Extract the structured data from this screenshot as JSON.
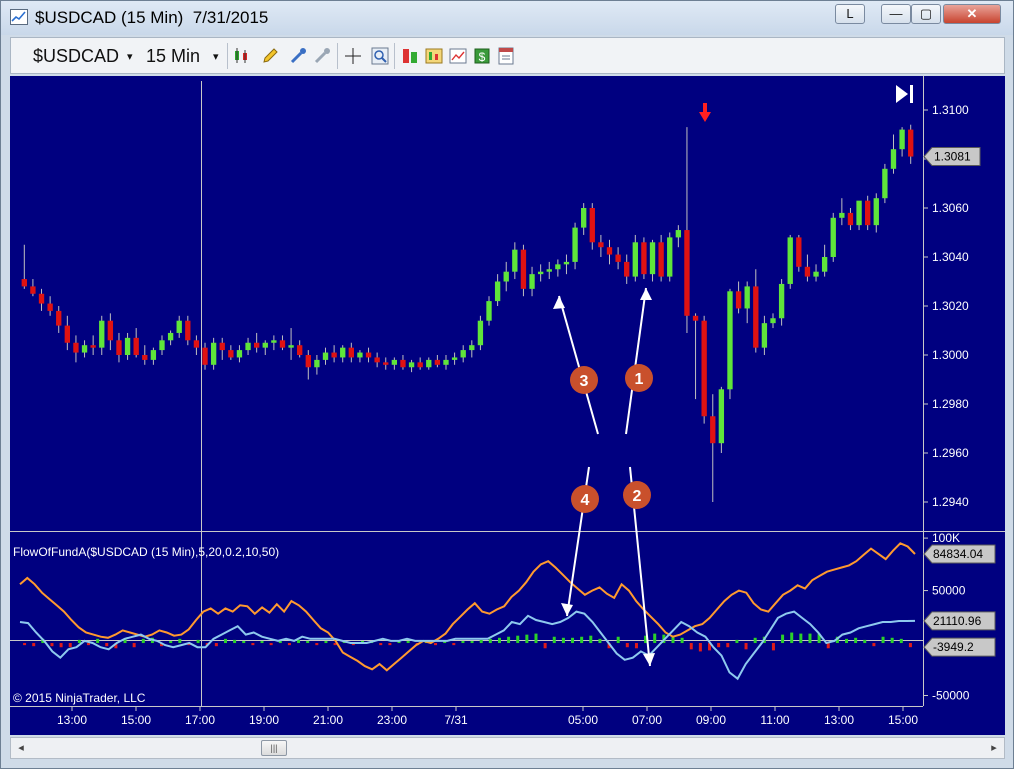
{
  "window": {
    "title": "$USDCAD (15 Min)  7/31/2015",
    "buttons": {
      "layout": "L",
      "minimize": "—",
      "maximize": "▢",
      "close": "✕"
    }
  },
  "toolbar": {
    "instrument": "$USDCAD",
    "instrument_arrow": "▾",
    "interval": "15 Min",
    "interval_arrow": "▾",
    "icons": [
      "candlestick-icon",
      "pencil-icon",
      "eyedropper-icon",
      "magnet-icon",
      "crosshair-icon",
      "zoom-icon",
      "strategy-icon",
      "bar-type-icon",
      "data-box-icon",
      "dollar-icon",
      "properties-icon"
    ]
  },
  "colors": {
    "background": "#000080",
    "up_candle": "#5fe53a",
    "down_candle": "#e01212",
    "wick": "#c0c0c0",
    "fund_line": "#ff9a2e",
    "signal_line": "#8ec9ee",
    "histogram_up": "#2bd12b",
    "histogram_down": "#e01a1a",
    "callout": "#c9502c",
    "scale_box": "#c8c8c8"
  },
  "chart_data": [
    {
      "type": "candlestick",
      "title": "$USDCAD (15 Min)",
      "price_axis_ticks": [
        "1.3100",
        "1.3080",
        "1.3060",
        "1.3040",
        "1.3020",
        "1.3000",
        "1.2980",
        "1.2960",
        "1.2940"
      ],
      "ylim": [
        1.2924,
        1.3111
      ],
      "time_axis_ticks": [
        "13:00",
        "15:00",
        "17:00",
        "19:00",
        "21:00",
        "23:00",
        "7/31",
        "05:00",
        "07:00",
        "09:00",
        "11:00",
        "13:00",
        "15:00"
      ],
      "last_price_marker": "1.3081",
      "skip_to_end_icon": "skip-to-end-icon",
      "event_marker": "down-arrow-icon",
      "ohlc": [
        [
          1.3031,
          1.3045,
          1.3027,
          1.3028
        ],
        [
          1.3028,
          1.3031,
          1.3024,
          1.3025
        ],
        [
          1.3025,
          1.3027,
          1.3018,
          1.3021
        ],
        [
          1.3021,
          1.3024,
          1.3016,
          1.3018
        ],
        [
          1.3018,
          1.302,
          1.3009,
          1.3012
        ],
        [
          1.3012,
          1.3016,
          1.3002,
          1.3005
        ],
        [
          1.3005,
          1.3008,
          1.2997,
          1.3001
        ],
        [
          1.3001,
          1.3006,
          1.2999,
          1.3004
        ],
        [
          1.3004,
          1.3008,
          1.3,
          1.3003
        ],
        [
          1.3003,
          1.3016,
          1.3,
          1.3014
        ],
        [
          1.3014,
          1.3017,
          1.3002,
          1.3006
        ],
        [
          1.3006,
          1.3009,
          1.2997,
          1.3
        ],
        [
          1.3,
          1.3009,
          1.2998,
          1.3007
        ],
        [
          1.3007,
          1.3011,
          1.2999,
          1.3
        ],
        [
          1.3,
          1.3004,
          1.2996,
          1.2998
        ],
        [
          1.2998,
          1.3003,
          1.2996,
          1.3002
        ],
        [
          1.3002,
          1.3008,
          1.3,
          1.3006
        ],
        [
          1.3006,
          1.301,
          1.3004,
          1.3009
        ],
        [
          1.3009,
          1.3016,
          1.3007,
          1.3014
        ],
        [
          1.3014,
          1.3016,
          1.3004,
          1.3006
        ],
        [
          1.3006,
          1.3008,
          1.3,
          1.3003
        ],
        [
          1.3003,
          1.3005,
          1.2994,
          1.2996
        ],
        [
          1.2996,
          1.3007,
          1.2994,
          1.3005
        ],
        [
          1.3005,
          1.3007,
          1.2998,
          1.3002
        ],
        [
          1.3002,
          1.3004,
          1.2998,
          1.2999
        ],
        [
          1.2999,
          1.3004,
          1.2997,
          1.3002
        ],
        [
          1.3002,
          1.3007,
          1.3,
          1.3005
        ],
        [
          1.3005,
          1.3009,
          1.3001,
          1.3003
        ],
        [
          1.3003,
          1.3006,
          1.3,
          1.3005
        ],
        [
          1.3005,
          1.3008,
          1.3002,
          1.3006
        ],
        [
          1.3006,
          1.3008,
          1.3002,
          1.3003
        ],
        [
          1.3003,
          1.3011,
          1.2998,
          1.3004
        ],
        [
          1.3004,
          1.3006,
          1.2999,
          1.3
        ],
        [
          1.3,
          1.3002,
          1.299,
          1.2995
        ],
        [
          1.2995,
          1.3,
          1.2992,
          1.2998
        ],
        [
          1.2998,
          1.3003,
          1.2996,
          1.3001
        ],
        [
          1.3001,
          1.3004,
          1.2997,
          1.2999
        ],
        [
          1.2999,
          1.3004,
          1.2997,
          1.3003
        ],
        [
          1.3003,
          1.3005,
          1.2997,
          1.2999
        ],
        [
          1.2999,
          1.3002,
          1.2997,
          1.3001
        ],
        [
          1.3001,
          1.3003,
          1.2997,
          1.2999
        ],
        [
          1.2999,
          1.3001,
          1.2995,
          1.2997
        ],
        [
          1.2997,
          1.2999,
          1.2994,
          1.2996
        ],
        [
          1.2996,
          1.2999,
          1.2994,
          1.2998
        ],
        [
          1.2998,
          1.3,
          1.2994,
          1.2995
        ],
        [
          1.2995,
          1.2998,
          1.2993,
          1.2997
        ],
        [
          1.2997,
          1.2999,
          1.2994,
          1.2995
        ],
        [
          1.2995,
          1.2999,
          1.2994,
          1.2998
        ],
        [
          1.2998,
          1.3,
          1.2995,
          1.2996
        ],
        [
          1.2996,
          1.3,
          1.2994,
          1.2998
        ],
        [
          1.2998,
          1.3001,
          1.2996,
          1.2999
        ],
        [
          1.2999,
          1.3004,
          1.2997,
          1.3002
        ],
        [
          1.3002,
          1.3006,
          1.2999,
          1.3004
        ],
        [
          1.3004,
          1.3016,
          1.3002,
          1.3014
        ],
        [
          1.3014,
          1.3024,
          1.3012,
          1.3022
        ],
        [
          1.3022,
          1.3033,
          1.302,
          1.303
        ],
        [
          1.303,
          1.3038,
          1.3026,
          1.3034
        ],
        [
          1.3034,
          1.3046,
          1.3031,
          1.3043
        ],
        [
          1.3043,
          1.3045,
          1.3024,
          1.3027
        ],
        [
          1.3027,
          1.3036,
          1.3024,
          1.3033
        ],
        [
          1.3033,
          1.3037,
          1.303,
          1.3034
        ],
        [
          1.3034,
          1.3038,
          1.3031,
          1.3035
        ],
        [
          1.3035,
          1.3039,
          1.3032,
          1.3037
        ],
        [
          1.3037,
          1.3041,
          1.3033,
          1.3038
        ],
        [
          1.3038,
          1.3054,
          1.3035,
          1.3052
        ],
        [
          1.3052,
          1.3062,
          1.3049,
          1.306
        ],
        [
          1.306,
          1.3062,
          1.3043,
          1.3046
        ],
        [
          1.3046,
          1.3049,
          1.304,
          1.3044
        ],
        [
          1.3044,
          1.3047,
          1.3037,
          1.3041
        ],
        [
          1.3041,
          1.3044,
          1.3035,
          1.3038
        ],
        [
          1.3038,
          1.3041,
          1.3029,
          1.3032
        ],
        [
          1.3032,
          1.3049,
          1.303,
          1.3046
        ],
        [
          1.3046,
          1.3048,
          1.3031,
          1.3033
        ],
        [
          1.3033,
          1.3047,
          1.303,
          1.3046
        ],
        [
          1.3046,
          1.3049,
          1.303,
          1.3032
        ],
        [
          1.3032,
          1.305,
          1.303,
          1.3048
        ],
        [
          1.3048,
          1.3053,
          1.3044,
          1.3051
        ],
        [
          1.3051,
          1.3093,
          1.3009,
          1.3016
        ],
        [
          1.3016,
          1.3017,
          1.2982,
          1.3014
        ],
        [
          1.3014,
          1.3016,
          1.2972,
          1.2975
        ],
        [
          1.2975,
          1.2984,
          1.294,
          1.2964
        ],
        [
          1.2964,
          1.2987,
          1.296,
          1.2986
        ],
        [
          1.2986,
          1.3027,
          1.2982,
          1.3026
        ],
        [
          1.3026,
          1.303,
          1.3017,
          1.3019
        ],
        [
          1.3019,
          1.303,
          1.3013,
          1.3028
        ],
        [
          1.3028,
          1.3035,
          1.3001,
          1.3003
        ],
        [
          1.3003,
          1.3016,
          1.3,
          1.3013
        ],
        [
          1.3013,
          1.3017,
          1.3011,
          1.3015
        ],
        [
          1.3015,
          1.3031,
          1.3012,
          1.3029
        ],
        [
          1.3029,
          1.3049,
          1.3027,
          1.3048
        ],
        [
          1.3048,
          1.3049,
          1.3034,
          1.3036
        ],
        [
          1.3036,
          1.3041,
          1.303,
          1.3032
        ],
        [
          1.3032,
          1.3037,
          1.303,
          1.3034
        ],
        [
          1.3034,
          1.3045,
          1.3032,
          1.304
        ],
        [
          1.304,
          1.3058,
          1.3038,
          1.3056
        ],
        [
          1.3056,
          1.3064,
          1.3053,
          1.3058
        ],
        [
          1.3058,
          1.306,
          1.3051,
          1.3053
        ],
        [
          1.3053,
          1.3061,
          1.3051,
          1.3063
        ],
        [
          1.3063,
          1.3065,
          1.3051,
          1.3053
        ],
        [
          1.3053,
          1.3066,
          1.305,
          1.3064
        ],
        [
          1.3064,
          1.3078,
          1.3062,
          1.3076
        ],
        [
          1.3076,
          1.309,
          1.3074,
          1.3084
        ],
        [
          1.3084,
          1.3093,
          1.3081,
          1.3092
        ],
        [
          1.3092,
          1.3094,
          1.3078,
          1.3081
        ]
      ]
    },
    {
      "type": "line",
      "title": "FlowOfFundA($USDCAD (15 Min),5,20,0.2,10,50)",
      "axis_ticks": [
        "100K",
        "50000",
        "-50000"
      ],
      "ylim": [
        -60000,
        102000
      ],
      "value_markers": [
        "84834.04",
        "21110.96",
        "-3949.2"
      ],
      "copyright": "© 2015 NinjaTrader, LLC",
      "series": [
        {
          "values": [
            56000,
            62000,
            56000,
            48000,
            42000,
            36000,
            30000,
            22000,
            15000,
            10000,
            8000,
            6000,
            5000,
            8000,
            12000,
            10000,
            8000,
            6000,
            8000,
            12000,
            10000,
            7000,
            8000,
            13000,
            22000,
            30000,
            33000,
            28000,
            33000,
            30000,
            36000,
            35000,
            28000,
            34000,
            29000,
            37000,
            30000,
            40000,
            36000,
            30000,
            22000,
            14000,
            10000,
            2000,
            -9000,
            -13000,
            -17000,
            -22000,
            -25000,
            -20000,
            -26000,
            -20000,
            -14000,
            -8000,
            -2000,
            2000,
            0,
            4000,
            9000,
            18000,
            25000,
            32000,
            38000,
            30000,
            28000,
            32000,
            35000,
            44000,
            50000,
            58000,
            68000,
            75000,
            78000,
            72000,
            65000,
            58000,
            52000,
            46000,
            50000,
            53000,
            47000,
            43000,
            56000,
            50000,
            40000,
            32000,
            25000,
            18000,
            10000,
            6000,
            8000,
            12000,
            16000,
            18000,
            24000,
            32000,
            40000,
            46000,
            50000,
            48000,
            38000,
            32000,
            30000,
            38000,
            46000,
            50000,
            55000,
            52000,
            60000,
            64000,
            68000,
            70000,
            72000,
            74000,
            78000,
            84000,
            90000,
            85000,
            80000,
            88000,
            95000,
            92000,
            84834
          ]
        },
        {
          "values": [
            20000,
            19000,
            10000,
            2000,
            -8000,
            -14000,
            -6000,
            -4000,
            2000,
            0,
            -4000,
            -6000,
            0,
            4000,
            6000,
            8000,
            4000,
            2000,
            -2000,
            -4000,
            -2000,
            0,
            -4000,
            -4000,
            4000,
            8000,
            12000,
            16000,
            8000,
            10000,
            6000,
            4000,
            2000,
            4000,
            2000,
            6000,
            4000,
            4000,
            4000,
            4000,
            2000,
            0,
            0,
            0,
            2000,
            4000,
            2000,
            2000,
            4000,
            2000,
            2000,
            2000,
            2000,
            2000,
            4000,
            4000,
            4000,
            4000,
            4000,
            8000,
            12000,
            20000,
            18000,
            26000,
            22000,
            20000,
            18000,
            20000,
            24000,
            30000,
            28000,
            20000,
            10000,
            0,
            -10000,
            -16000,
            -14000,
            -8000,
            -12000,
            -4000,
            4000,
            12000,
            20000,
            16000,
            10000,
            6000,
            -4000,
            -12000,
            -28000,
            -34000,
            -20000,
            -10000,
            0,
            12000,
            24000,
            28000,
            30000,
            24000,
            18000,
            10000,
            0,
            2000,
            8000,
            10000,
            14000,
            16000,
            18000,
            20000,
            20000,
            21000,
            21000,
            21111
          ]
        }
      ],
      "histogram": [
        -2000,
        -3000,
        4000,
        -3000,
        -4000,
        -4000,
        3000,
        -2000,
        4000,
        -3000,
        -5000,
        4000,
        -4000,
        4000,
        5000,
        -3000,
        2000,
        4000,
        -2000,
        3000,
        -2000,
        -3000,
        4000,
        3000,
        2000,
        -2000,
        2000,
        -2000,
        2000,
        -2000,
        3000,
        2000,
        -2000,
        2000,
        -2000,
        2000,
        -2000,
        2000,
        2000,
        -2000,
        -2000,
        2000,
        2000,
        -2000,
        2000,
        -2000,
        2000,
        -2000,
        2000,
        2000,
        3000,
        4000,
        5000,
        6000,
        7000,
        8000,
        9000,
        -5000,
        6000,
        5000,
        5000,
        6000,
        7000,
        4000,
        -5000,
        6000,
        -4000,
        -5000,
        7000,
        9000,
        8000,
        6000,
        5000,
        -6000,
        -8000,
        -7000,
        -4000,
        -4000,
        3000,
        -6000,
        5000,
        6000,
        -7000,
        8000,
        10000,
        9000,
        9000,
        9000,
        -5000,
        6000,
        4000,
        5000,
        3000,
        -3000,
        6000,
        5000,
        4000,
        -3949
      ]
    }
  ],
  "annotations": [
    {
      "label": "1",
      "target": "price pullback low near 06:30"
    },
    {
      "label": "2",
      "target": "indicator dip near 07:00"
    },
    {
      "label": "3",
      "target": "price low near 04:30"
    },
    {
      "label": "4",
      "target": "indicator rise near 04:30"
    }
  ]
}
